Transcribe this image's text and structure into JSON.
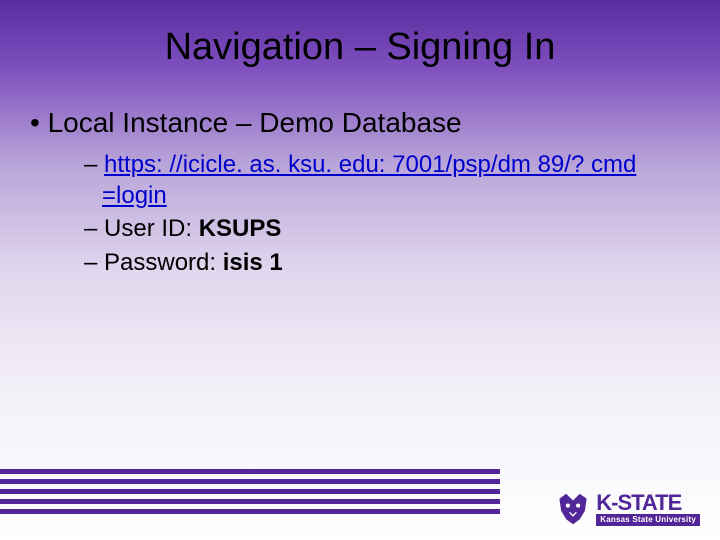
{
  "title": "Navigation – Signing In",
  "bullets": {
    "main": "Local Instance – Demo Database",
    "link": "https: //icicle. as. ksu. edu: 7001/psp/dm 89/? cmd =login",
    "user_label": "User ID:  ",
    "user_value": "KSUPS",
    "pass_label": "Password:  ",
    "pass_value": "isis 1"
  },
  "logo": {
    "brand": "K-STATE",
    "sub": "Kansas State University"
  }
}
